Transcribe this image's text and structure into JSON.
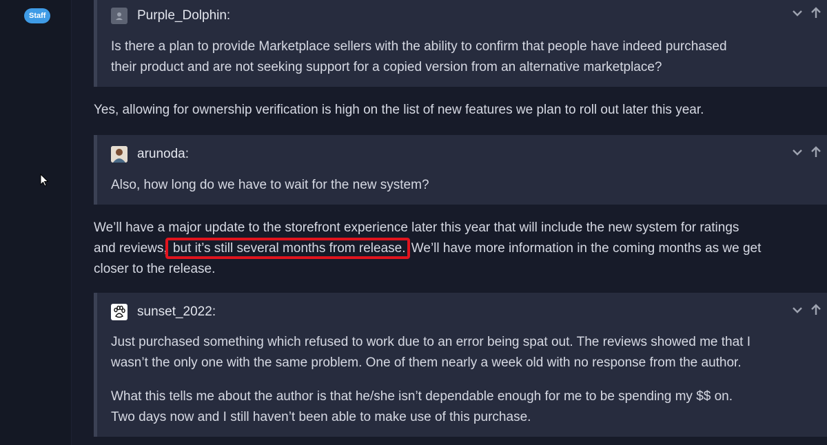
{
  "sidebar": {
    "badge": "Staff"
  },
  "quotes": [
    {
      "username": "Purple_Dolphin:",
      "avatar_icon": "default-user-icon",
      "lines": [
        "Is there a plan to provide Marketplace sellers with the ability to confirm that people have indeed purchased",
        "their product and are not seeking support for a copied version from an alternative marketplace?"
      ]
    },
    {
      "username": "arunoda:",
      "avatar_icon": "photo-avatar",
      "lines": [
        "Also, how long do we have to wait for the new system?"
      ]
    },
    {
      "username": "sunset_2022:",
      "avatar_icon": "paw-icon",
      "lines": [
        "Just purchased something which refused to work due to an error being spat out. The reviews showed me that I",
        "wasn’t the only one with the same problem. One of them nearly a week old with no response from the author.",
        "What this tells me about the author is that he/she isn’t dependable enough for me to be spending my $$ on.",
        "Two days now and I still haven’t been able to make use of this purchase."
      ]
    }
  ],
  "replies": [
    {
      "lines": [
        "Yes, allowing for ownership verification is high on the list of new features we plan to roll out later this year."
      ]
    },
    {
      "line1": "We’ll have a major update to the storefront experience later this year that will include the new system for ratings",
      "line2_before": "and reviews,",
      "line2_highlight": " but it’s still several months from release.",
      "line2_after": " We’ll have more information in the coming months as we get",
      "line3": "closer to the release."
    }
  ],
  "colors": {
    "accent": "#3f9be6",
    "highlight": "#e0141e",
    "quote_bg": "#272c3e",
    "page_bg": "#171b29"
  }
}
